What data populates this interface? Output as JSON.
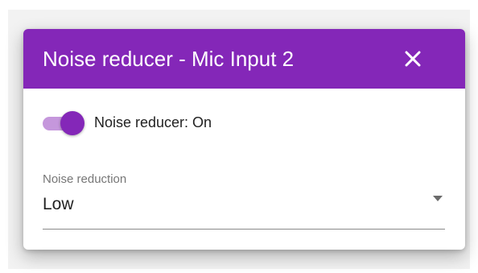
{
  "dialog": {
    "title": "Noise reducer - Mic Input 2",
    "close_icon": "close-icon",
    "header_color": "#8427b8"
  },
  "noise_reducer_switch": {
    "label": "Noise reducer: On",
    "checked": true,
    "accent_color": "#8427b8"
  },
  "noise_reduction_select": {
    "label": "Noise reduction",
    "selected_value": "Low",
    "arrow_icon": "dropdown-arrow-icon"
  }
}
